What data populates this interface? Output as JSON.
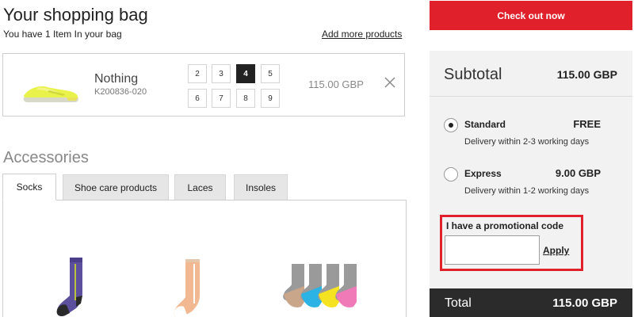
{
  "bag": {
    "title": "Your shopping bag",
    "count_text": "You have  1 Item In your bag",
    "add_more": "Add more products"
  },
  "item": {
    "name": "Nothing",
    "code": "K200836-020",
    "sizes": [
      "2",
      "3",
      "4",
      "5",
      "6",
      "7",
      "8",
      "9"
    ],
    "selected_size": "4",
    "price": "115.00 GBP",
    "remove_icon": "close-icon",
    "image_colors": {
      "upper": "#e8f24a",
      "sole": "#d8d8c8",
      "accent": "#f3f58a"
    }
  },
  "accessories": {
    "title": "Accessories",
    "tabs": [
      {
        "label": "Socks",
        "active": true
      },
      {
        "label": "Shoe care products",
        "active": false
      },
      {
        "label": "Laces",
        "active": false
      },
      {
        "label": "Insoles",
        "active": false
      }
    ],
    "products": [
      {
        "name": "purple-sock",
        "colors": [
          "#5b4f9e",
          "#2a2a2a",
          "#b9c23c"
        ]
      },
      {
        "name": "peach-sock",
        "colors": [
          "#f2b892",
          "#ffffff",
          "#e6c6a8"
        ]
      },
      {
        "name": "multi-sock-pack",
        "colors": [
          "#9a9a9a",
          "#2bb3e6",
          "#f5e321",
          "#f07ab8",
          "#c9a58a"
        ]
      }
    ]
  },
  "checkout": {
    "label": "Check out now",
    "color": "#e0202a"
  },
  "summary": {
    "subtotal_label": "Subtotal",
    "subtotal_value": "115.00 GBP",
    "shipping": [
      {
        "name": "Standard",
        "price": "FREE",
        "desc": "Delivery within 2-3 working days",
        "selected": true
      },
      {
        "name": "Express",
        "price": "9.00 GBP",
        "desc": "Delivery within 1-2 working days",
        "selected": false
      }
    ],
    "promo": {
      "label": "I have a promotional code",
      "value": "",
      "placeholder": "",
      "apply": "Apply",
      "highlight_color": "#e0202a"
    },
    "total_label": "Total",
    "total_value": "115.00 GBP"
  }
}
